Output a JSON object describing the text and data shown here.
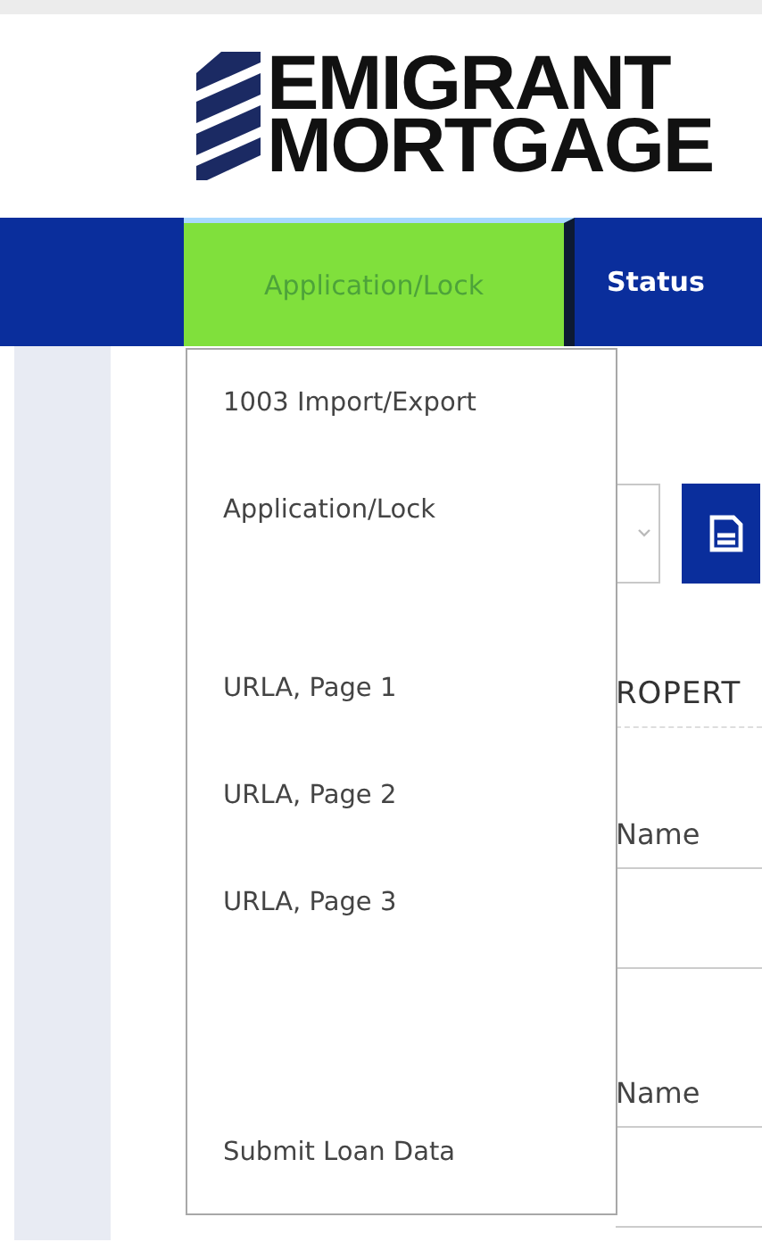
{
  "logo": {
    "line_1": "EMIGRANT",
    "line_2": "MORTGAGE"
  },
  "nav": {
    "tabs": [
      {
        "label": "Application/Lock",
        "selected": true
      },
      {
        "label": "Status",
        "selected": false
      }
    ]
  },
  "dropdown": {
    "items": [
      {
        "kind": "item",
        "label": "1003 Import/Export"
      },
      {
        "kind": "item",
        "label": "Application/Lock"
      },
      {
        "kind": "spacer"
      },
      {
        "kind": "item",
        "label": "URLA, Page 1"
      },
      {
        "kind": "item",
        "label": "URLA, Page 2"
      },
      {
        "kind": "item",
        "label": "URLA, Page 3"
      },
      {
        "kind": "spacer"
      },
      {
        "kind": "spacer"
      },
      {
        "kind": "item",
        "label": "Submit Loan Data"
      }
    ]
  },
  "content": {
    "section_heading": "ROPERT",
    "fields": [
      {
        "label": "Name"
      },
      {
        "label": "Name"
      }
    ]
  }
}
